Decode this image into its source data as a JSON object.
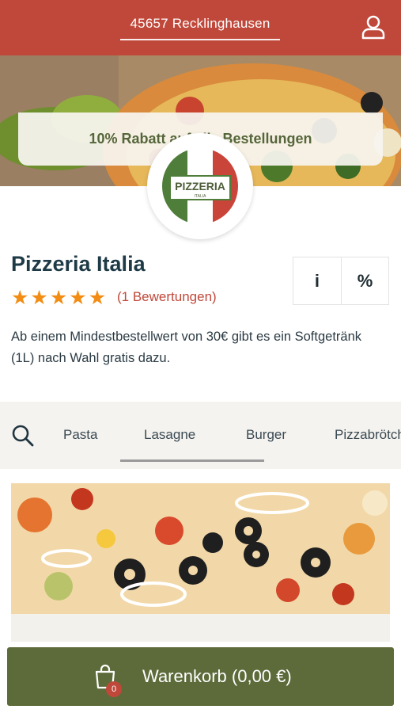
{
  "header": {
    "location": "45657 Recklinghausen",
    "user_icon": "user-icon"
  },
  "hero": {
    "promo_text": "10% Rabatt auf alle Bestellungen"
  },
  "logo": {
    "text": "PIZZERIA",
    "subtext": "ITALIA"
  },
  "restaurant": {
    "name": "Pizzeria Italia",
    "rating": 5,
    "reviews": "(1 Bewertungen)",
    "info_button": "i",
    "discount_button": "%",
    "description": "Ab einem Mindestbestellwert von 30€ gibt es ein Softgetränk (1L) nach Wahl gratis dazu."
  },
  "categories": {
    "items": [
      "Pasta",
      "Lasagne",
      "Burger",
      "Pizzabrötchen"
    ],
    "active": "Lasagne"
  },
  "cart": {
    "label": "Warenkorb (0,00 €)",
    "count": "0"
  },
  "colors": {
    "brand_red": "#c0483a",
    "brand_green": "#5d6b3a",
    "star_orange": "#f28c13"
  }
}
